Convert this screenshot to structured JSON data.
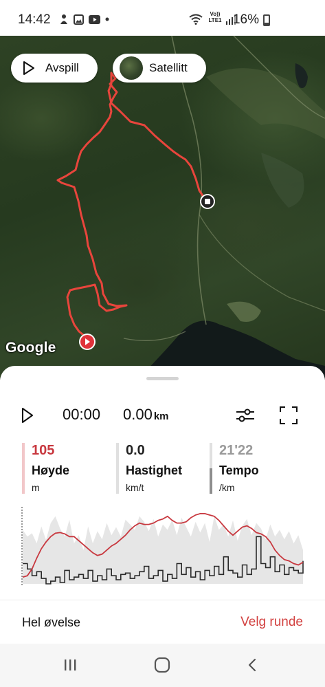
{
  "status_bar": {
    "time": "14:42",
    "network": "Vo)) LTE1",
    "battery": "16%"
  },
  "map": {
    "play_label": "Avspill",
    "satellite_label": "Satellitt",
    "provider": "Google",
    "route_color": "#e8453c"
  },
  "playback": {
    "time": "00:00",
    "distance": "0.00",
    "distance_unit": "km"
  },
  "stats": {
    "height": {
      "value": "105",
      "label": "Høyde",
      "unit": "m",
      "color": "#c8383f"
    },
    "speed": {
      "value": "0.0",
      "label": "Hastighet",
      "unit": "km/t"
    },
    "pace": {
      "value": "21'22",
      "label": "Tempo",
      "unit": "/km",
      "bar_level": 0.5
    }
  },
  "chart_data": {
    "type": "line",
    "series": [
      {
        "values": [
          10,
          12,
          22,
          38,
          52,
          62,
          70,
          75,
          76,
          74,
          70,
          70,
          64,
          58,
          52,
          46,
          42,
          44,
          50,
          56,
          60,
          66,
          72,
          80,
          86,
          90,
          88,
          88,
          90,
          94,
          96,
          100,
          94,
          90,
          90,
          92,
          98,
          102,
          104,
          104,
          102,
          100,
          94,
          86,
          78,
          72,
          78,
          84,
          86,
          82,
          76,
          74,
          70,
          62,
          50,
          42,
          36,
          34,
          30,
          28,
          32
        ],
        "color": "#c8383f"
      },
      {
        "values": [
          30,
          22,
          12,
          18,
          8,
          0,
          4,
          10,
          2,
          20,
          6,
          10,
          14,
          8,
          20,
          4,
          12,
          6,
          22,
          12,
          6,
          14,
          16,
          8,
          12,
          18,
          26,
          8,
          12,
          20,
          4,
          14,
          8,
          30,
          14,
          24,
          10,
          18,
          6,
          20,
          12,
          26,
          14,
          40,
          20,
          16,
          10,
          28,
          14,
          22,
          70,
          30,
          24,
          40,
          18,
          28,
          14,
          24,
          20,
          16,
          34
        ],
        "color": "#2a2a2a"
      },
      {
        "values": [
          80,
          70,
          75,
          60,
          85,
          65,
          90,
          100,
          82,
          70,
          95,
          60,
          72,
          50,
          85,
          60,
          78,
          66,
          90,
          72,
          84,
          70,
          95,
          88,
          80,
          100,
          92,
          78,
          96,
          70,
          88,
          80,
          95,
          72,
          98,
          84,
          70,
          92,
          76,
          90,
          62,
          100,
          80,
          88,
          70,
          94,
          64,
          86,
          96,
          72,
          90,
          82,
          66,
          88,
          70,
          80,
          66,
          78,
          60,
          72,
          50
        ],
        "color": "#e6e6e6"
      }
    ]
  },
  "footer": {
    "whole_exercise": "Hel øvelse",
    "select_lap": "Velg runde",
    "accent": "#d2403f"
  }
}
